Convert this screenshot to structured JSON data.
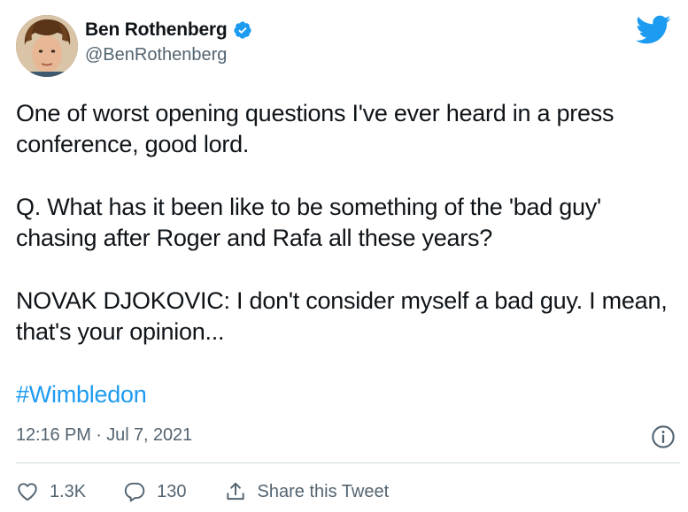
{
  "author": {
    "display_name": "Ben Rothenberg",
    "handle": "@BenRothenberg",
    "verified": true
  },
  "tweet": {
    "paragraphs": [
      "One of worst opening questions I've ever heard in a press conference, good lord.",
      "Q. What has it been like to be something of the 'bad guy' chasing after Roger and Rafa all these years?",
      "NOVAK DJOKOVIC: I don't consider myself a bad guy. I mean, that's your opinion..."
    ],
    "hashtag": "#Wimbledon",
    "timestamp": "12:16 PM · Jul 7, 2021"
  },
  "actions": {
    "likes": "1.3K",
    "replies": "130",
    "share_label": "Share this Tweet"
  },
  "icons": {
    "brand": "twitter-bird-icon",
    "verified": "verified-badge-icon",
    "info": "info-icon",
    "like": "heart-icon",
    "reply": "reply-icon",
    "share": "share-icon"
  },
  "colors": {
    "accent": "#1d9bf0",
    "text": "#0f1419",
    "secondary": "#536471",
    "divider": "#cfd9de"
  }
}
